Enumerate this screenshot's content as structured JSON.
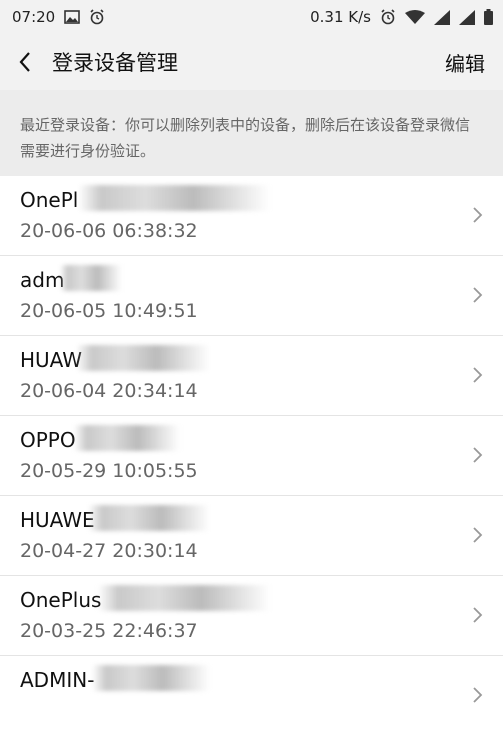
{
  "status": {
    "time": "07:20",
    "speed": "0.31 K/s"
  },
  "nav": {
    "title": "登录设备管理",
    "edit_label": "编辑"
  },
  "notice": "最近登录设备：你可以删除列表中的设备，删除后在该设备登录微信需要进行身份验证。",
  "devices": [
    {
      "name": "OnePl",
      "time": "20-06-06 06:38:32"
    },
    {
      "name": "adm",
      "time": "20-06-05 10:49:51"
    },
    {
      "name": "HUAW",
      "time": "20-06-04 20:34:14"
    },
    {
      "name": "OPPO",
      "time": "20-05-29 10:05:55"
    },
    {
      "name": "HUAWE",
      "time": "20-04-27 20:30:14"
    },
    {
      "name": "OnePlus",
      "time": "20-03-25 22:46:37"
    },
    {
      "name": "ADMIN-",
      "time": ""
    }
  ]
}
